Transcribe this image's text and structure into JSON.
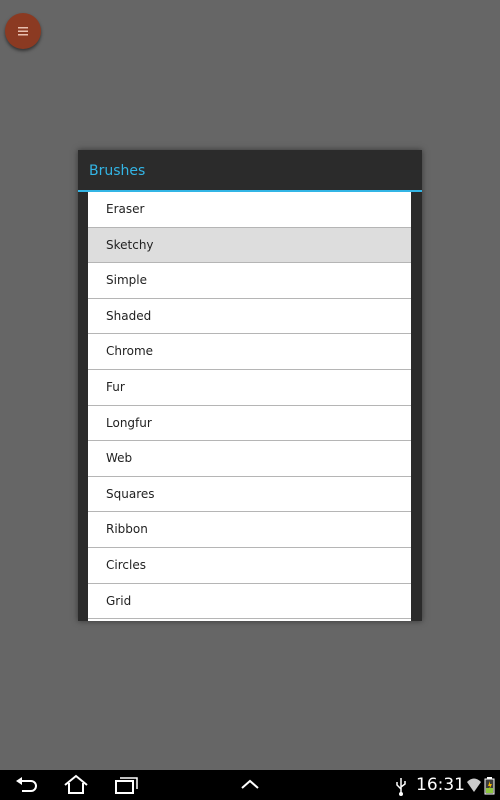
{
  "colors": {
    "accent": "#33b5e5",
    "menu_button": "#8b3a22",
    "background": "#666666"
  },
  "menu_button": {
    "icon": "hamburger-icon"
  },
  "dialog": {
    "title": "Brushes",
    "items": [
      {
        "label": "Eraser",
        "selected": false
      },
      {
        "label": "Sketchy",
        "selected": true
      },
      {
        "label": "Simple",
        "selected": false
      },
      {
        "label": "Shaded",
        "selected": false
      },
      {
        "label": "Chrome",
        "selected": false
      },
      {
        "label": "Fur",
        "selected": false
      },
      {
        "label": "Longfur",
        "selected": false
      },
      {
        "label": "Web",
        "selected": false
      },
      {
        "label": "Squares",
        "selected": false
      },
      {
        "label": "Ribbon",
        "selected": false
      },
      {
        "label": "Circles",
        "selected": false
      },
      {
        "label": "Grid",
        "selected": false
      }
    ]
  },
  "navbar": {
    "buttons": [
      "back-icon",
      "home-icon",
      "recent-apps-icon",
      "chevron-up-icon"
    ],
    "status_icons": [
      "usb-icon",
      "wifi-icon",
      "battery-icon"
    ],
    "clock": "16:31"
  }
}
